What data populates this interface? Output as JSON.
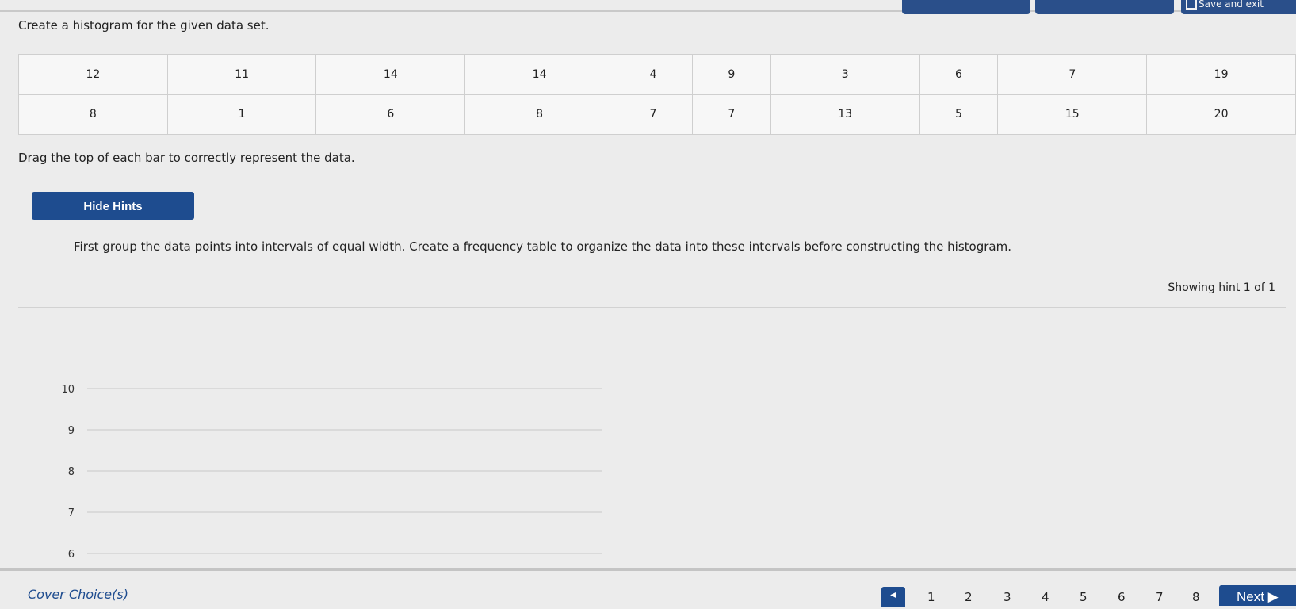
{
  "question": "Create a histogram for the given data set.",
  "data_table": {
    "row1": [
      "12",
      "11",
      "14",
      "14",
      "4",
      "9",
      "3",
      "6",
      "7",
      "19"
    ],
    "row2": [
      "8",
      "1",
      "6",
      "8",
      "7",
      "7",
      "13",
      "5",
      "15",
      "20"
    ]
  },
  "instruction": "Drag the top of each bar to correctly represent the data.",
  "hints": {
    "hide_label": "Hide Hints",
    "text": "First group the data points into intervals of equal width. Create a frequency table to organize the data into these intervals before constructing the histogram.",
    "count": "Showing hint 1 of 1"
  },
  "toolbar": {
    "save_label": "Save and exit"
  },
  "chart_data": {
    "type": "bar",
    "y_ticks": [
      "10",
      "9",
      "8",
      "7",
      "6"
    ],
    "grid": true
  },
  "bottom_nav": {
    "cover_label": "Cover Choice(s)",
    "pages": [
      "1",
      "2",
      "3",
      "4",
      "5",
      "6",
      "7",
      "8"
    ],
    "next_label": "Next ▶"
  },
  "colors": {
    "accent": "#1e4c8f",
    "background": "#ececec"
  }
}
